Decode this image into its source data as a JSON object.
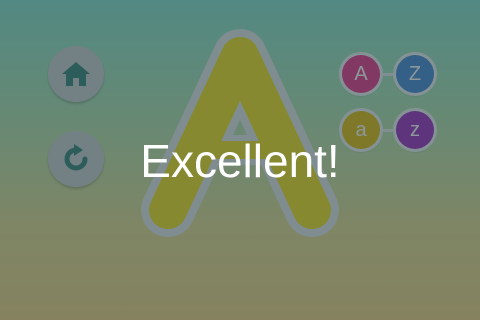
{
  "message": "Excellent!",
  "letter": {
    "glyph": "A",
    "trace_color": "#f2e22a"
  },
  "buttons": {
    "home": {
      "icon": "home-icon"
    },
    "reload": {
      "icon": "reload-icon"
    }
  },
  "case_options": [
    {
      "label": "A",
      "color": "#e8408f"
    },
    {
      "label": "Z",
      "color": "#4f8ed8"
    },
    {
      "label": "a",
      "color": "#e2c01a"
    },
    {
      "label": "z",
      "color": "#a23bc2"
    }
  ],
  "colors": {
    "button_bg": "#cfd2d3",
    "icon_color": "#3f8a80",
    "overlay": "rgba(26,48,54,0.5)"
  }
}
